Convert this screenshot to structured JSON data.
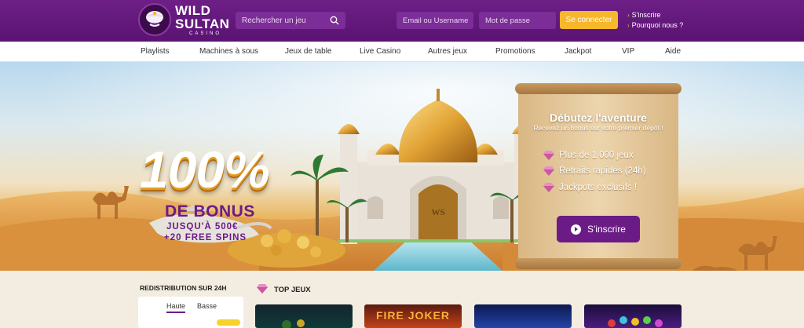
{
  "header": {
    "logo": {
      "line1": "WILD",
      "line2": "SULTAN",
      "line3": "CASINO"
    },
    "search_placeholder": "Rechercher un jeu",
    "email_placeholder": "Email ou Username",
    "password_placeholder": "Mot de passe",
    "login_label": "Se connecter",
    "links": [
      "S'inscrire",
      "Pourquoi nous ?"
    ]
  },
  "nav": [
    "Playlists",
    "Machines à sous",
    "Jeux de table",
    "Live Casino",
    "Autres jeux",
    "Promotions",
    "Jackpot",
    "VIP",
    "Aide"
  ],
  "hero": {
    "headline": "100%",
    "line1": "DE BONUS",
    "line2": "JUSQU'À 500€",
    "line3": "+20 FREE SPINS",
    "door_text": "WS",
    "scroll": {
      "title": "Débutez l'aventure",
      "subtitle": "Recevez un bonus sur votre premier dépôt !",
      "items": [
        "Plus de 1 000 jeux",
        "Retraits rapides (24h)",
        "Jackpots exclusifs !"
      ],
      "button": "S'inscrire"
    }
  },
  "sidebar": {
    "title": "REDISTRIBUTION SUR 24H",
    "tabs": [
      "Haute",
      "Basse"
    ]
  },
  "top_games": {
    "title": "TOP JEUX",
    "games": [
      "FIRE JOKER"
    ]
  },
  "colors": {
    "brand_purple": "#6b1b86",
    "accent_yellow": "#f6b72b",
    "header_bg": "#5a1372"
  },
  "icons": [
    "turban-logo-icon",
    "search-icon",
    "arrow-icon",
    "gem-icon",
    "play-icon"
  ]
}
